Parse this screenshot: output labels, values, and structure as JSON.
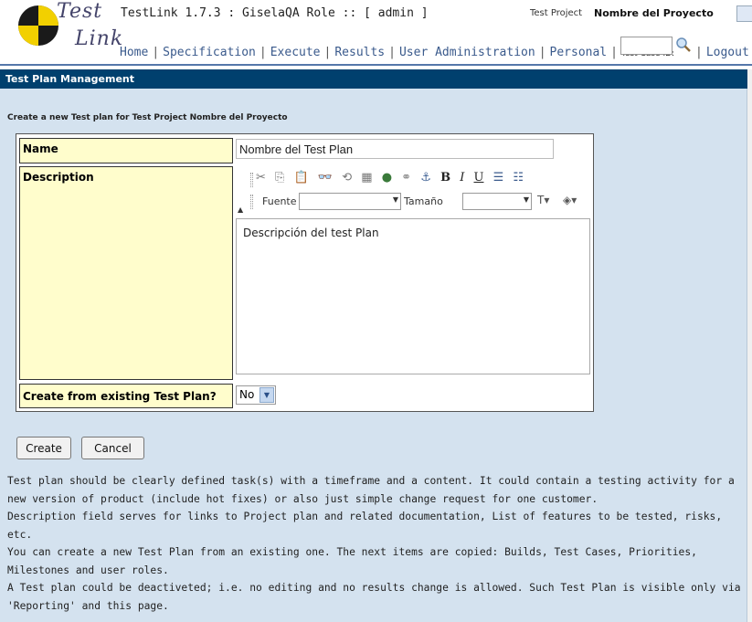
{
  "header": {
    "logo_word1": "Test",
    "logo_word2": "Link",
    "app_title": "TestLink 1.7.3 : GiselaQA Role :: [ admin ]",
    "project_label": "Test Project",
    "project_name": "Nombre del Proyecto"
  },
  "nav": {
    "items": [
      "Home",
      "Specification",
      "Execute",
      "Results",
      "User Administration",
      "Personal"
    ],
    "tcid_label": "Test Case ID:",
    "tcid_value": "",
    "logout": "Logout"
  },
  "page": {
    "title": "Test Plan Management",
    "create_heading": "Create a new Test plan for Test Project Nombre del Proyecto"
  },
  "form": {
    "name_label": "Name",
    "name_value": "Nombre del Test Plan",
    "description_label": "Description",
    "description_value": "Descripción del test Plan",
    "create_from_label": "Create from existing Test Plan?",
    "create_from_value": "No",
    "editor": {
      "font_label": "Fuente",
      "size_label": "Tamaño",
      "toolbar_icons": [
        "cut-icon",
        "copy-icon",
        "paste-icon",
        "find-icon",
        "replace-icon",
        "table-icon",
        "image-icon",
        "link-icon",
        "anchor-icon",
        "bold-icon",
        "italic-icon",
        "underline-icon",
        "ordered-list-icon",
        "unordered-list-icon"
      ],
      "bold_glyph": "B",
      "italic_glyph": "I",
      "underline_glyph": "U"
    }
  },
  "buttons": {
    "create": "Create",
    "cancel": "Cancel"
  },
  "help": [
    "Test plan should be clearly defined task(s) with a timeframe and a content. It could contain a testing activity for a new version of product (include hot fixes) or also just simple change request for one customer.",
    "Description field serves for links to Project plan and related documentation, List of features to be tested, risks, etc.",
    "You can create a new Test Plan from an existing one. The next items are copied: Builds, Test Cases, Priorities, Milestones and user roles.",
    "A Test plan could be deactiveted; i.e. no editing and no results change is allowed. Such Test Plan is visible only via 'Reporting' and this page."
  ],
  "colors": {
    "titlebar_bg": "#00406e",
    "content_bg": "#d4e2ef",
    "label_bg": "#fffdcc",
    "link": "#3a5a8c",
    "logo_yellow": "#f2d000"
  }
}
